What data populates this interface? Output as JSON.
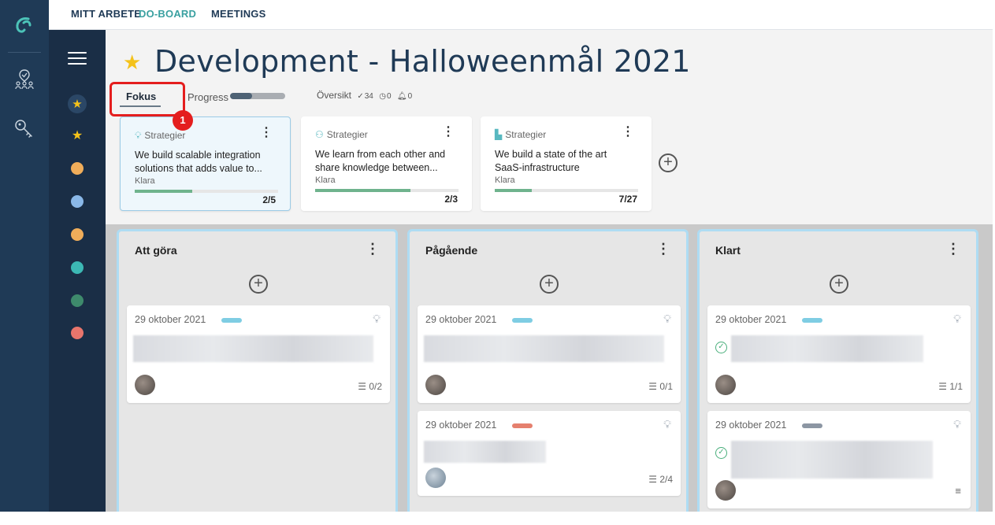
{
  "topnav": {
    "items": [
      "MITT ARBETE",
      "DO-BOARD",
      "MEETINGS"
    ],
    "active": "DO-BOARD"
  },
  "header": {
    "title": "Development - Halloweenmål 2021",
    "tabs": {
      "fokus": "Fokus",
      "progress": "Progress"
    },
    "progress_fraction": 0.4,
    "overview": {
      "label": "Översikt",
      "done": "34",
      "time": "0",
      "alerts": "0"
    },
    "badge": "1"
  },
  "strategies": [
    {
      "category": "Strategier",
      "text": "We build scalable integration solutions that adds value to...",
      "status": "Klara",
      "count": "2/5",
      "progress": 0.4,
      "icon": "bulb-icon"
    },
    {
      "category": "Strategier",
      "text": "We learn from each other and share knowledge between...",
      "status": "Klara",
      "count": "2/3",
      "progress": 0.667,
      "icon": "people-icon"
    },
    {
      "category": "Strategier",
      "text": "We build a state of the art SaaS-infrastructure",
      "status": "Klara",
      "count": "7/27",
      "progress": 0.26,
      "icon": "factory-icon"
    }
  ],
  "columns": [
    {
      "title": "Att göra",
      "cards": [
        {
          "date": "29 oktober 2021",
          "tag_color": "#7fcde3",
          "checklist": "0/2"
        }
      ]
    },
    {
      "title": "Pågående",
      "cards": [
        {
          "date": "29 oktober 2021",
          "tag_color": "#7fcde3",
          "checklist": "0/1"
        },
        {
          "date": "29 oktober 2021",
          "tag_color": "#e5806e",
          "checklist": "2/4"
        }
      ]
    },
    {
      "title": "Klart",
      "cards": [
        {
          "date": "29 oktober 2021",
          "tag_color": "#7fcde3",
          "checklist": "1/1"
        },
        {
          "date": "29 oktober 2021",
          "tag_color": "#8c96a3"
        }
      ]
    }
  ],
  "sidebar_dots": [
    "#f4c21a",
    "#f4c21a",
    "#f0ad5a",
    "#8ab8e8",
    "#f0ad5a",
    "#3cb8b4",
    "#3e8a6c",
    "#e8756c"
  ],
  "colors": {
    "rail": "#1f3a56",
    "accent": "#3aa0a0",
    "highlight": "#e41e1e"
  }
}
